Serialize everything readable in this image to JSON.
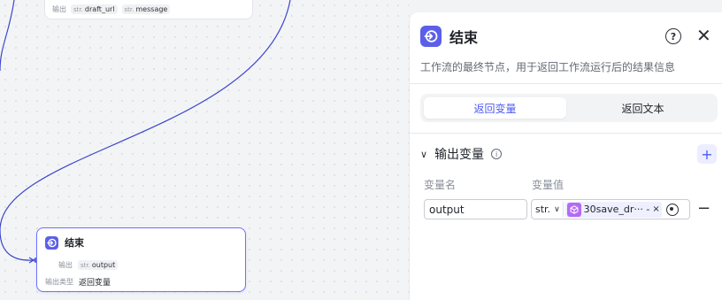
{
  "canvas": {
    "top_node": {
      "output_label": "输出",
      "outputs": [
        {
          "type": "str.",
          "name": "draft_url"
        },
        {
          "type": "str.",
          "name": "message"
        }
      ]
    },
    "end_node": {
      "title": "结束",
      "output_label": "输出",
      "output": {
        "type": "str.",
        "name": "output"
      },
      "output_type_label": "输出类型",
      "output_type_value": "返回变量"
    }
  },
  "panel": {
    "title": "结束",
    "description": "工作流的最终节点，用于返回工作流运行后的结果信息",
    "tabs": [
      {
        "label": "返回变量",
        "active": true
      },
      {
        "label": "返回文本",
        "active": false
      }
    ],
    "section_title": "输出变量",
    "columns": {
      "name": "变量名",
      "value": "变量值"
    },
    "row": {
      "name_value": "output",
      "type": "str.",
      "reference": "30save_dr··· - ×",
      "reference_text": "30save_dr··· -",
      "remove_glyph": "×"
    }
  },
  "colors": {
    "accent": "#4e5bf0",
    "end_icon": "#5b5fe8",
    "ref_cube": "#b46bf4"
  }
}
